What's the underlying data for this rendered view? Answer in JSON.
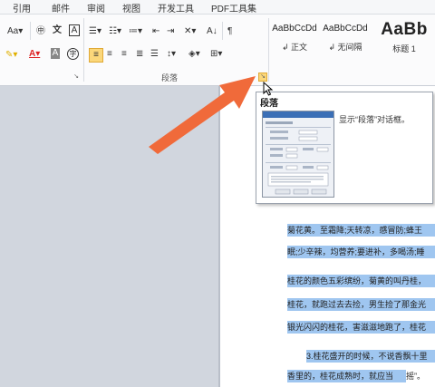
{
  "tabs": [
    "引用",
    "邮件",
    "审阅",
    "视图",
    "开发工具",
    "PDF工具集"
  ],
  "ribbon": {
    "font_size_label": "Aa",
    "wen_label": "文",
    "a_label": "A",
    "sort_label": "A↓",
    "paragraph_group_label": "段落",
    "styles": [
      {
        "preview": "AaBbCcDd",
        "name": "↲ 正文"
      },
      {
        "preview": "AaBbCcDd",
        "name": "↲ 无间隔"
      },
      {
        "preview": "AaBb",
        "name": "标题 1"
      }
    ]
  },
  "tooltip": {
    "title": "段落",
    "description": "显示“段落”对话框。"
  },
  "document": {
    "lines": [
      "菊花黄。至霜降;天转凉，感冒防;蜂王",
      "眠;少辛辣，均营养;要进补，多喝汤;睡",
      "桂花的颜色五彩缤纷，菊黄的叫丹桂，",
      "桂花，就跑过去去捡，男生捡了那金光",
      "银光闪闪的桂花，害滋滋地跑了，桂花",
      "3.桂花盛开的时候，不说香飘十里",
      "香里的，桂花成熟时，就应当"
    ],
    "last_line_tail": "摇”。"
  },
  "colors": {
    "arrow": "#f06a3a",
    "highlight": "#9fc6f0",
    "active_button": "#fbd77a"
  }
}
